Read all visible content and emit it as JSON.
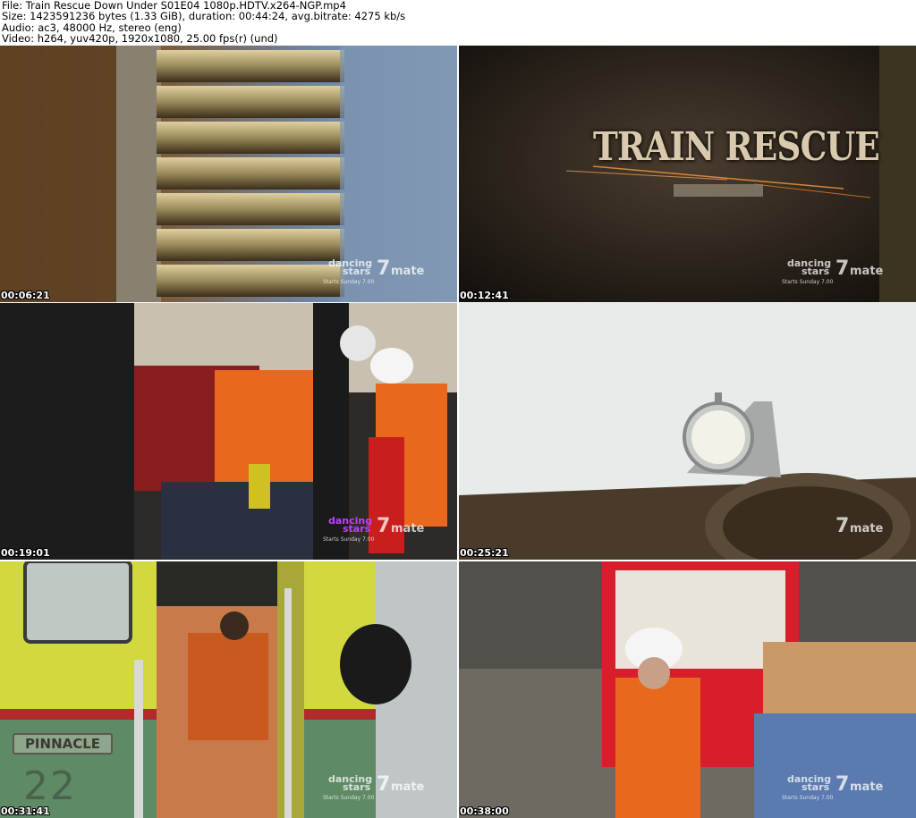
{
  "header": {
    "file": "File: Train Rescue Down Under S01E04 1080p.HDTV.x264-NGP.mp4",
    "size": "Size: 1423591236 bytes (1.33 GiB), duration: 00:44:24, avg.bitrate: 4275 kb/s",
    "audio": "Audio: ac3, 48000 Hz, stereo (eng)",
    "video": "Video: h264, yuv420p, 1920x1080, 25.00 fps(r) (und)"
  },
  "thumbs": [
    {
      "timestamp": "00:06:21",
      "logo": {
        "line1": "dancing",
        "line2": "stars",
        "seven": "7",
        "mate": "mate",
        "sub": "Starts Sunday 7.00"
      }
    },
    {
      "timestamp": "00:12:41",
      "title": "TRAIN RESCUE",
      "logo": {
        "line1": "dancing",
        "line2": "stars",
        "seven": "7",
        "mate": "mate",
        "sub": "Starts Sunday 7.00"
      }
    },
    {
      "timestamp": "00:19:01",
      "logo": {
        "line1": "dancing",
        "line2": "stars",
        "seven": "7",
        "mate": "mate",
        "sub": "Starts Sunday 7.00"
      }
    },
    {
      "timestamp": "00:25:21",
      "logo": {
        "seven": "7",
        "mate": "mate"
      }
    },
    {
      "timestamp": "00:31:41",
      "plate": "PINNACLE",
      "plate_number": "22",
      "logo": {
        "line1": "dancing",
        "line2": "stars",
        "seven": "7",
        "mate": "mate",
        "sub": "Starts Sunday 7.00"
      }
    },
    {
      "timestamp": "00:38:00",
      "logo": {
        "line1": "dancing",
        "line2": "stars",
        "seven": "7",
        "mate": "mate",
        "sub": "Starts Sunday 7.00"
      }
    }
  ]
}
